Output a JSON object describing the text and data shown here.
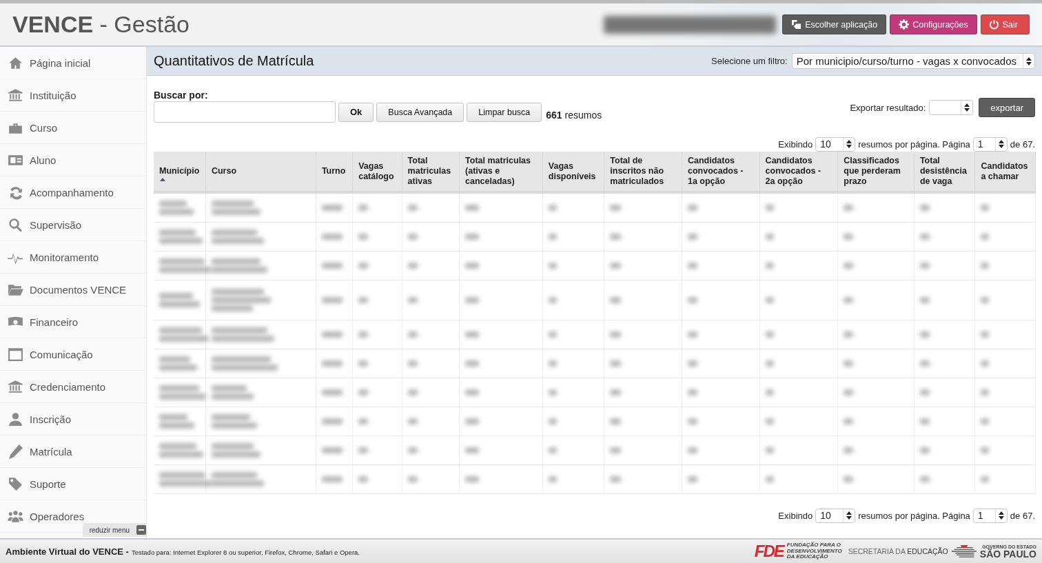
{
  "header": {
    "brand": "VENCE",
    "subtitle": "- Gestão",
    "buttons": [
      {
        "label": "Escolher aplicação",
        "kind": "apps"
      },
      {
        "label": "Configurações",
        "kind": "config"
      },
      {
        "label": "Sair",
        "kind": "exit"
      }
    ]
  },
  "sidebar": {
    "items": [
      {
        "label": "Página inicial"
      },
      {
        "label": "Instituição"
      },
      {
        "label": "Curso"
      },
      {
        "label": "Aluno"
      },
      {
        "label": "Acompanhamento"
      },
      {
        "label": "Supervisão"
      },
      {
        "label": "Monitoramento"
      },
      {
        "label": "Documentos VENCE"
      },
      {
        "label": "Financeiro"
      },
      {
        "label": "Comunicação"
      },
      {
        "label": "Credenciamento"
      },
      {
        "label": "Inscrição"
      },
      {
        "label": "Matrícula"
      },
      {
        "label": "Suporte"
      },
      {
        "label": "Operadores"
      }
    ],
    "collapse": "reduzir menu"
  },
  "page": {
    "title": "Quantitativos de Matrícula",
    "filter_label": "Selecione um filtro:",
    "filter_value": "Por municipio/curso/turno - vagas x convocados"
  },
  "search": {
    "label": "Buscar por:",
    "ok": "Ok",
    "advanced": "Busca Avançada",
    "clear": "Limpar busca",
    "count": "661",
    "count_label": "resumos",
    "export_label": "Exportar resultado:",
    "export_button": "exportar"
  },
  "pagination_top": {
    "prefix": "Exibindo",
    "per_page": "10",
    "middle": "resumos por página. Página",
    "page": "1",
    "suffix": "de 67."
  },
  "table": {
    "columns": [
      {
        "label": "Município",
        "sorted": true
      },
      {
        "label": "Curso",
        "sorted": false
      },
      {
        "label": "Turno",
        "sorted": false
      },
      {
        "label": "Vagas catálogo",
        "sorted": false
      },
      {
        "label": "Total matriculas ativas",
        "sorted": false
      },
      {
        "label": "Total matriculas (ativas e canceladas)",
        "sorted": false
      },
      {
        "label": "Vagas disponíveis",
        "sorted": false
      },
      {
        "label": "Total de inscritos não matriculados",
        "sorted": false
      },
      {
        "label": "Candidatos convocados - 1a opção",
        "sorted": false
      },
      {
        "label": "Candidatos convocados - 2a opção",
        "sorted": false
      },
      {
        "label": "Classificados que perderam prazo",
        "sorted": false
      },
      {
        "label": "Total desistência de vaga",
        "sorted": false
      },
      {
        "label": "Candidatos a chamar",
        "sorted": false
      }
    ],
    "rows": [
      {
        "kind": "blurred"
      },
      {
        "kind": "blurred"
      },
      {
        "kind": "blurred"
      },
      {
        "kind": "blurred-tall"
      },
      {
        "kind": "blurred"
      },
      {
        "kind": "blurred"
      },
      {
        "kind": "blurred"
      },
      {
        "kind": "blurred"
      },
      {
        "kind": "blurred"
      },
      {
        "kind": "blurred"
      }
    ]
  },
  "pagination_bottom": {
    "prefix": "Exibindo",
    "per_page": "10",
    "middle": "resumos por página. Página",
    "page": "1",
    "suffix": "de 67."
  },
  "footer": {
    "title": "Ambiente Virtual do VENCE -",
    "note": "Testado para: Internet Explorer 8 ou superior, Firefox, Chrome, Safari e Opera.",
    "fde": "FDE",
    "fde_name": [
      "FUNDAÇÃO PARA O",
      "DESENVOLVIMENTO",
      "DA EDUCAÇÃO"
    ],
    "secretaria": "SECRETARIA DA",
    "educacao": "EDUCAÇÃO",
    "gov": "GOVERNO DO ESTADO",
    "sp": "SÃO PAULO"
  }
}
